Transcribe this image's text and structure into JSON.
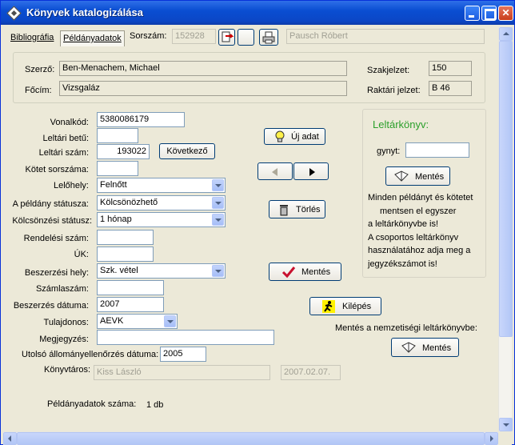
{
  "window": {
    "title": "Könyvek katalogizálása"
  },
  "toolbar": {
    "tabs": [
      {
        "label": "Bibliográfia"
      },
      {
        "label": "Példányadatok"
      }
    ],
    "serial_label": "Sorszám:",
    "serial_value": "152928",
    "user_value": "Pausch Róbert"
  },
  "header": {
    "author_label": "Szerző:",
    "author_value": "Ben-Menachem, Michael",
    "title_label": "Főcím:",
    "title_value": "Vizsgaláz",
    "call_number_label": "Szakjelzet:",
    "call_number_value": "150",
    "storage_label": "Raktári jelzet:",
    "storage_value": "B 46"
  },
  "form": {
    "barcode_label": "Vonalkód:",
    "barcode_value": "5380086179",
    "inv_letter_label": "Leltári betű:",
    "inv_letter_value": "",
    "inv_number_label": "Leltári szám:",
    "inv_number_value": "193022",
    "next_button": "Következő",
    "volume_label": "Kötet sorszáma:",
    "volume_value": "",
    "location_label": "Lelőhely:",
    "location_value": "Felnőtt",
    "status_label": "A példány státusza:",
    "status_value": "Kölcsönözhető",
    "loan_status_label": "Kölcsönzési státusz:",
    "loan_status_value": "1 hónap",
    "order_number_label": "Rendelési szám:",
    "order_number_value": "",
    "uk_label": "ÚK:",
    "uk_value": "",
    "source_label": "Beszerzési hely:",
    "source_value": "Szk. vétel",
    "invoice_label": "Számlaszám:",
    "invoice_value": "",
    "date_label": "Beszerzés dátuma:",
    "date_value": "2007",
    "owner_label": "Tulajdonos:",
    "owner_value": "AEVK",
    "note_label": "Megjegyzés:",
    "note_value": "",
    "last_check_label": "Utolsó állományellenőrzés dátuma:",
    "last_check_value": "2005",
    "librarian_label": "Könyvtáros:",
    "librarian_value": "Kiss László",
    "librarian_date_value": "2007.02.07.",
    "copies_label": "Példányadatok száma:",
    "copies_value": "1 db"
  },
  "actions": {
    "new_label": "Új adat",
    "delete_label": "Törlés",
    "save_label": "Mentés",
    "exit_label": "Kilépés"
  },
  "inventory_book": {
    "title": "Leltárkönyv:",
    "gynyt_label": "gynyt:",
    "gynyt_value": "",
    "save_label": "Mentés",
    "info_lines": [
      "Minden példányt és kötetet",
      "mentsen el egyszer",
      "a leltárkönyvbe is!",
      "A csoportos leltárkönyv",
      "használatához adja meg a",
      "jegyzékszámot is!"
    ]
  },
  "national": {
    "label": "Mentés a nemzetiségi leltárkönyvbe:",
    "save_label": "Mentés"
  },
  "colors": {
    "titlebar": "#0A4ED2",
    "inventory_title": "#2A9F2A",
    "delete_check": "#C8102E"
  }
}
